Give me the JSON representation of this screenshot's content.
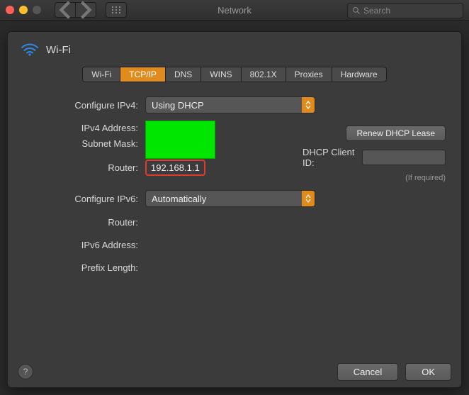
{
  "window": {
    "title": "Network",
    "search_placeholder": "Search"
  },
  "panel": {
    "title": "Wi-Fi",
    "tabs": [
      "Wi-Fi",
      "TCP/IP",
      "DNS",
      "WINS",
      "802.1X",
      "Proxies",
      "Hardware"
    ],
    "active_tab": "TCP/IP",
    "labels": {
      "configure_ipv4": "Configure IPv4:",
      "ipv4_address": "IPv4 Address:",
      "subnet_mask": "Subnet Mask:",
      "router": "Router:",
      "configure_ipv6": "Configure IPv6:",
      "router6": "Router:",
      "ipv6_address": "IPv6 Address:",
      "prefix_length": "Prefix Length:",
      "dhcp_client_id": "DHCP Client ID:",
      "if_required": "(If required)"
    },
    "values": {
      "configure_ipv4": "Using DHCP",
      "router": "192.168.1.1",
      "configure_ipv6": "Automatically"
    },
    "buttons": {
      "renew_dhcp": "Renew DHCP Lease",
      "cancel": "Cancel",
      "ok": "OK"
    }
  }
}
